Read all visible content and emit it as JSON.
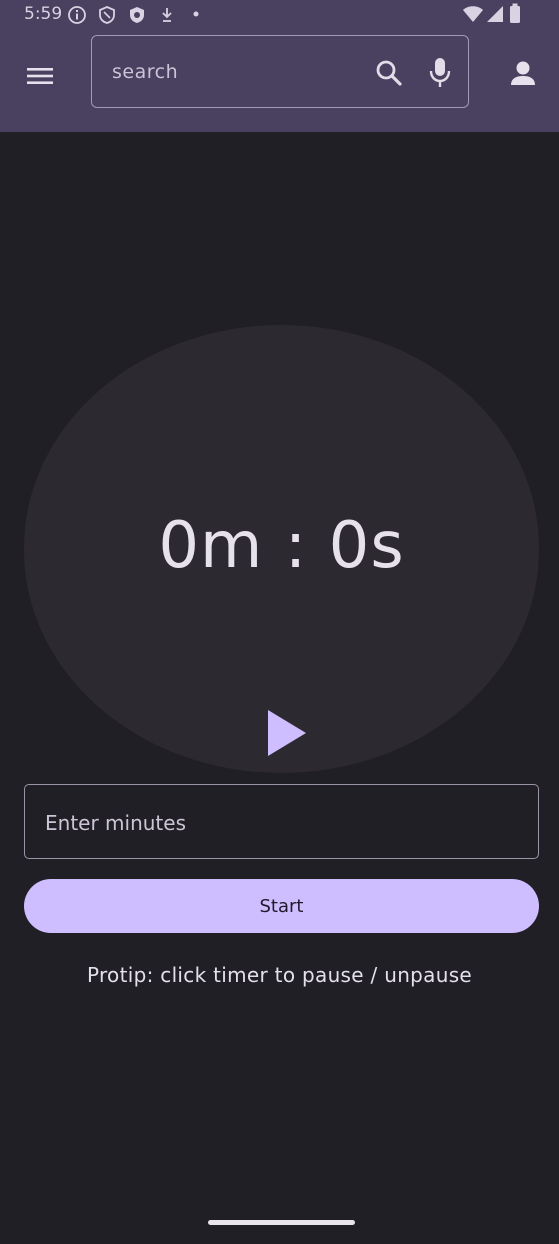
{
  "status_bar": {
    "time": "5:59",
    "left_icons": [
      "info-icon",
      "shield-icon",
      "shield-filled-icon",
      "download-icon",
      "dot-icon"
    ],
    "right_icons": [
      "wifi-icon",
      "signal-icon",
      "battery-icon"
    ]
  },
  "app_bar": {
    "search": {
      "placeholder": "search"
    },
    "icons": [
      "menu-icon",
      "search-icon",
      "mic-icon",
      "account-icon"
    ]
  },
  "timer": {
    "display": "0m : 0s",
    "play_icon": "play-icon"
  },
  "minutes_field": {
    "placeholder": "Enter minutes"
  },
  "start_button": {
    "label": "Start"
  },
  "protip": "Protip: click timer to pause / unpause",
  "colors": {
    "background": "#211f26",
    "app_bar": "#4a4060",
    "accent": "#cfbeff",
    "timer_surface": "#2c2a30"
  }
}
